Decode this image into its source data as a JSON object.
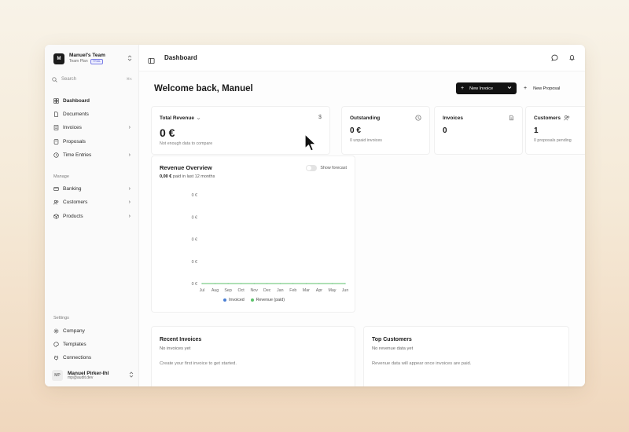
{
  "team": {
    "logo_letter": "M",
    "name": "Manuel's Team",
    "plan": "Team Plan",
    "badge": "TRIAL"
  },
  "search": {
    "label": "Search",
    "shortcut": "⌘K"
  },
  "nav": {
    "main": [
      {
        "label": "Dashboard",
        "icon": "dashboard-icon",
        "active": true,
        "has_arrow": false
      },
      {
        "label": "Documents",
        "icon": "document-icon",
        "has_arrow": false
      },
      {
        "label": "Invoices",
        "icon": "invoice-icon",
        "has_arrow": true
      },
      {
        "label": "Proposals",
        "icon": "proposal-icon",
        "has_arrow": false
      },
      {
        "label": "Time Entries",
        "icon": "clock-icon",
        "has_arrow": true
      }
    ],
    "manage_label": "Manage",
    "manage": [
      {
        "label": "Banking",
        "icon": "bank-icon",
        "has_arrow": true
      },
      {
        "label": "Customers",
        "icon": "customers-icon",
        "has_arrow": true
      },
      {
        "label": "Products",
        "icon": "box-icon",
        "has_arrow": true
      }
    ],
    "settings_label": "Settings",
    "settings": [
      {
        "label": "Company",
        "icon": "gear-icon"
      },
      {
        "label": "Templates",
        "icon": "palette-icon"
      },
      {
        "label": "Connections",
        "icon": "plug-icon"
      }
    ]
  },
  "user": {
    "initials": "MP",
    "name": "Manuel Pirker-Ihl",
    "email": "mp@audit.dev"
  },
  "topbar": {
    "title": "Dashboard"
  },
  "header": {
    "welcome": "Welcome back, Manuel",
    "new_invoice": "New Invoice",
    "new_proposal": "New Proposal"
  },
  "cards": {
    "total_revenue": {
      "title": "Total Revenue",
      "value": "0 €",
      "sub": "Not enough data to compare"
    },
    "outstanding": {
      "title": "Outstanding",
      "value": "0 €",
      "sub": "0 unpaid invoices"
    },
    "invoices": {
      "title": "Invoices",
      "value": "0"
    },
    "customers": {
      "title": "Customers",
      "value": "1",
      "sub": "0 proposals pending"
    }
  },
  "revenue_overview": {
    "title": "Revenue Overview",
    "amount": "0,00 €",
    "amount_suffix": "paid in last 12 months",
    "forecast_label": "Show forecast"
  },
  "chart_data": {
    "type": "line",
    "x": [
      "Jul",
      "Aug",
      "Sep",
      "Oct",
      "Nov",
      "Dec",
      "Jan",
      "Feb",
      "Mar",
      "Apr",
      "May",
      "Jun"
    ],
    "y_ticks": [
      "0 €",
      "0 €",
      "0 €",
      "0 €",
      "0 €"
    ],
    "series": [
      {
        "name": "Invoiced",
        "color": "#4a7fd4",
        "values": [
          0,
          0,
          0,
          0,
          0,
          0,
          0,
          0,
          0,
          0,
          0,
          0
        ]
      },
      {
        "name": "Revenue (paid)",
        "color": "#5cc26a",
        "values": [
          0,
          0,
          0,
          0,
          0,
          0,
          0,
          0,
          0,
          0,
          0,
          0
        ]
      }
    ],
    "legend_position": "bottom",
    "grid": false
  },
  "recent_invoices": {
    "title": "Recent Invoices",
    "status": "No invoices yet",
    "message": "Create your first invoice to get started."
  },
  "top_customers": {
    "title": "Top Customers",
    "status": "No revenue data yet",
    "message": "Revenue data will appear once invoices are paid."
  }
}
